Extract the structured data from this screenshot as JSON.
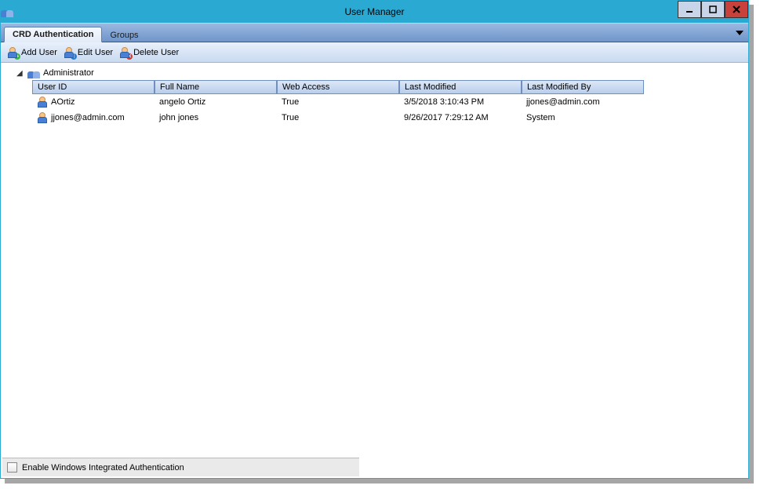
{
  "window": {
    "title": "User Manager"
  },
  "tabs": [
    {
      "label": "CRD Authentication",
      "active": true
    },
    {
      "label": "Groups",
      "active": false
    }
  ],
  "toolbar": {
    "add": "Add User",
    "edit": "Edit User",
    "delete": "Delete User"
  },
  "tree": {
    "root": "Administrator"
  },
  "columns": [
    "User ID",
    "Full Name",
    "Web Access",
    "Last Modified",
    "Last Modified By"
  ],
  "rows": [
    {
      "user_id": "AOrtiz",
      "full_name": "angelo Ortiz",
      "web_access": "True",
      "last_modified": "3/5/2018 3:10:43 PM",
      "last_modified_by": "jjones@admin.com"
    },
    {
      "user_id": "jjones@admin.com",
      "full_name": "john jones",
      "web_access": "True",
      "last_modified": "9/26/2017 7:29:12 AM",
      "last_modified_by": "System"
    }
  ],
  "footer": {
    "checkbox_label": "Enable Windows Integrated Authentication"
  }
}
